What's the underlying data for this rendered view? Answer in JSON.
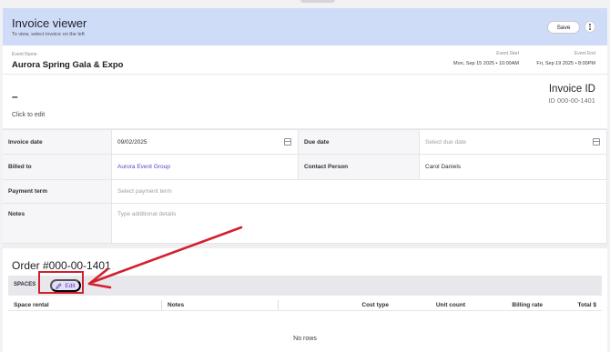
{
  "header": {
    "title": "Invoice viewer",
    "subtitle": "To view, select invoice on the left",
    "save_label": "Save"
  },
  "event": {
    "name_label": "Event Name",
    "name": "Aurora Spring Gala & Expo",
    "start_label": "Event Start",
    "start_value": "Mon, Sep 15 2025 • 10:00AM",
    "end_label": "Event End",
    "end_value": "Fri, Sep 19 2025 • 8:00PM"
  },
  "invoice": {
    "name_placeholder": "–",
    "click_to_edit": "Click to edit",
    "id_title": "Invoice ID",
    "id_value": "ID 000-00-1401"
  },
  "form": {
    "invoice_date_label": "Invoice date",
    "invoice_date_value": "09/02/2025",
    "due_date_label": "Due date",
    "due_date_placeholder": "Select due date",
    "billed_to_label": "Billed to",
    "billed_to_value": "Aurora Event Group",
    "contact_label": "Contact Person",
    "contact_value": "Carol Daniels",
    "payment_term_label": "Payment term",
    "payment_term_placeholder": "Select payment term",
    "notes_label": "Notes",
    "notes_placeholder": "Type additional details"
  },
  "order": {
    "title": "Order #000-00-1401",
    "spaces_label": "SPACES",
    "edit_label": "Edit",
    "columns": [
      "Space rental",
      "Notes",
      "Cost type",
      "Unit count",
      "Billing rate",
      "Total $"
    ],
    "empty_text": "No rows"
  },
  "colors": {
    "header_bg": "#cfdcf7",
    "accent": "#5b3ec2",
    "annotation": "#d3202f"
  }
}
